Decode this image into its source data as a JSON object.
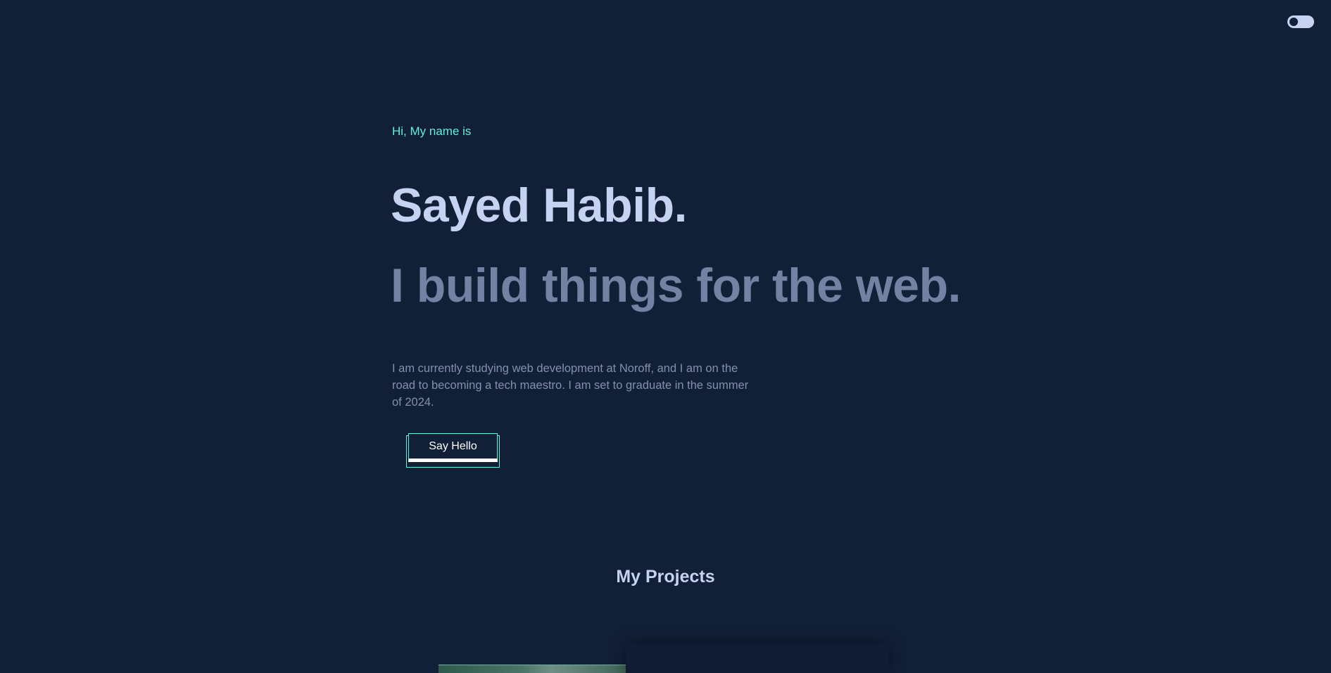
{
  "header": {
    "theme_toggle_icon": "toggle-switch-icon"
  },
  "hero": {
    "greeting": "Hi, My name is",
    "name": "Sayed Habib.",
    "tagline": "I build things for the web.",
    "intro": "I am currently studying web development at Noroff, and I am on the road to becoming a tech maestro. I am set to graduate in the summer of 2024.",
    "cta_label": "Say Hello"
  },
  "projects": {
    "title": "My Projects"
  },
  "colors": {
    "background": "#111f37",
    "accent": "#5ff2d6",
    "heading": "#c6d2f2",
    "muted_heading": "#7382a2",
    "body_text": "#8390ad"
  }
}
